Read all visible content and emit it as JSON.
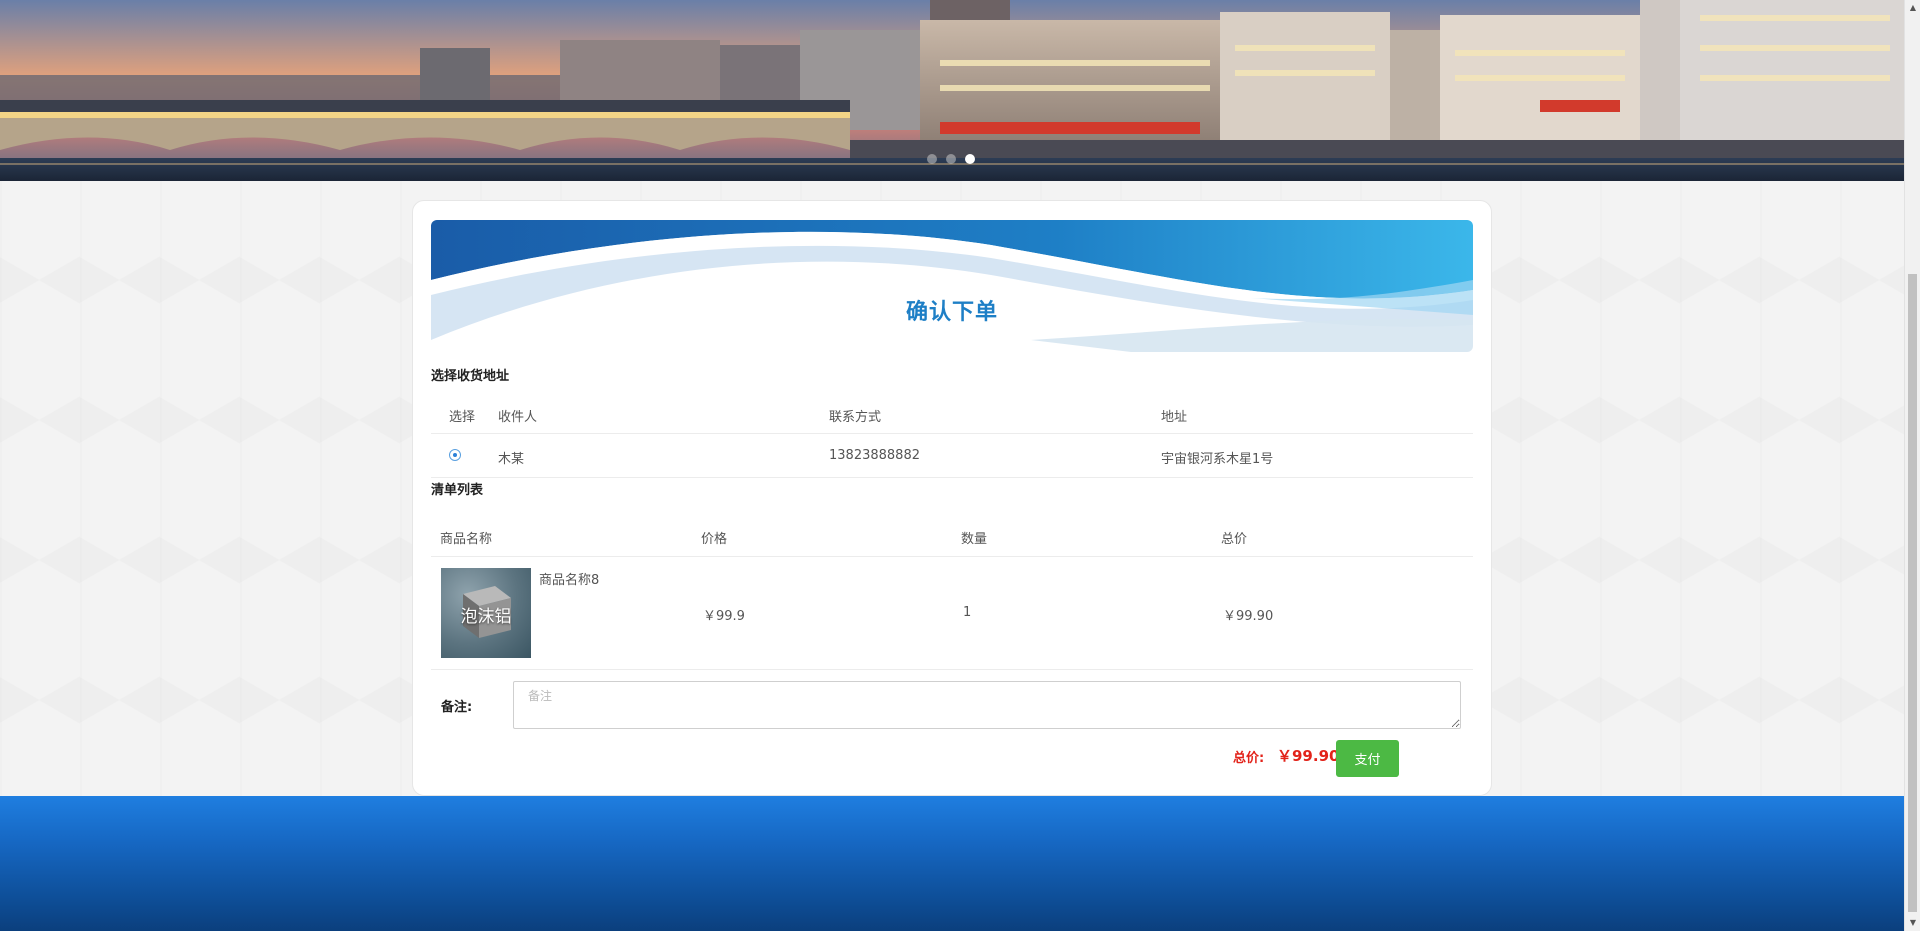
{
  "banner": {
    "slide_count": 3,
    "active_slide": 3
  },
  "order": {
    "title": "确认下单",
    "address_section_title": "选择收货地址",
    "address_table": {
      "headers": {
        "select": "选择",
        "recipient": "收件人",
        "contact": "联系方式",
        "address": "地址"
      },
      "rows": [
        {
          "selected": true,
          "recipient": "木某",
          "contact": "13823888882",
          "address": "宇宙银河系木星1号"
        }
      ]
    },
    "list_section_title": "清单列表",
    "item_table": {
      "headers": {
        "name": "商品名称",
        "price": "价格",
        "quantity": "数量",
        "total": "总价"
      },
      "rows": [
        {
          "image_text": "泡沫铝",
          "name": "商品名称8",
          "price": "￥99.9",
          "quantity": "1",
          "total": "￥99.90"
        }
      ]
    },
    "remark": {
      "label": "备注:",
      "placeholder": "备注",
      "value": ""
    },
    "total_label": "总价:",
    "total_value": "￥99.90",
    "pay_button": "支付"
  },
  "colors": {
    "accent_blue": "#1e7fc6",
    "pay_green": "#4cb944",
    "total_red": "#e2231a",
    "footer_blue": "#1667c2"
  }
}
